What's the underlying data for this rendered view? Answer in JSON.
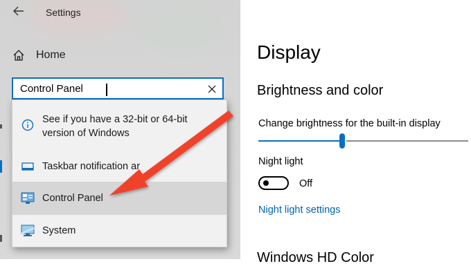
{
  "window": {
    "title": "Settings",
    "back_icon": "back-arrow-icon"
  },
  "sidebar": {
    "home_label": "Home",
    "search": {
      "value": "Control Panel",
      "placeholder": ""
    },
    "results": [
      {
        "icon": "info-icon",
        "label": "See if you have a 32-bit or 64-bit version of Windows",
        "line1": "See if you have a 32-bit or 64-bit",
        "line2": "version of Windows"
      },
      {
        "icon": "taskbar-icon",
        "label": "Taskbar notification ar"
      },
      {
        "icon": "control-panel-icon",
        "label": "Control Panel",
        "selected": true
      },
      {
        "icon": "system-monitor-icon",
        "label": "System"
      }
    ]
  },
  "main": {
    "title": "Display",
    "section": "Brightness and color",
    "brightness_label": "Change brightness for the built-in display",
    "brightness_value": 0.4,
    "night_light_label": "Night light",
    "night_light_state": "Off",
    "night_light_link": "Night light settings",
    "next_section": "Windows HD Color"
  },
  "colors": {
    "accent": "#0a6fc2",
    "link": "#0063b1",
    "annotation_arrow": "#f0432a"
  }
}
